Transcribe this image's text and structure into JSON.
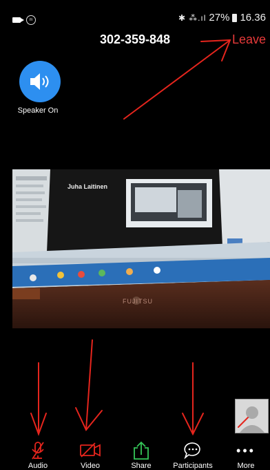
{
  "status_bar": {
    "battery": "27%",
    "time": "16.36",
    "icons": [
      "bluetooth-icon",
      "signal-icon"
    ]
  },
  "header": {
    "meeting_id": "302-359-848",
    "leave_label": "Leave"
  },
  "speaker": {
    "label": "Speaker On"
  },
  "video": {
    "presenter_name": "Juha Laitinen",
    "brand": "FUJITSU"
  },
  "toolbar": {
    "audio": "Audio",
    "video": "Video",
    "share": "Share",
    "participants": "Participants",
    "more": "More"
  },
  "colors": {
    "accent_blue": "#2d8ff0",
    "leave_red": "#e83a3a",
    "share_green": "#35c759",
    "annotation_red": "#e5251d"
  }
}
